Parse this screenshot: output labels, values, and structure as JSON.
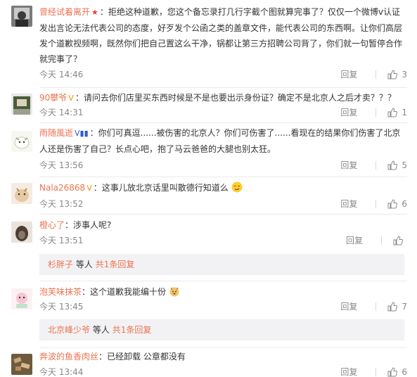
{
  "comments": [
    {
      "user": "曾经试着离开",
      "badge": "★",
      "text_lines": [
        "：拒绝这种道歉，您这个备忘录打几行字截个图就算完事了？仅仅一个微博v认证",
        "发出言论无法代表公司的态度，好歹发个公函之类的盖章文件，能代表公司的东西啊。让你们高层",
        "发个道歉视频啊，既然你们把自己置这么干净，锅都让第三方招聘公司背了，你们就一句暂停合作",
        "就完事了？"
      ],
      "time": "今天 14:46",
      "reply_label": "回复",
      "likes": "3"
    },
    {
      "user": "90攀爷",
      "badge": "V",
      "text_lines": [
        "：请问去你们店里买东西时候是不是也要出示身份证？确定不是北京人之后才卖？？？"
      ],
      "time": "今天 14:31",
      "reply_label": "回复",
      "likes": "1"
    },
    {
      "user": "雨随風逝",
      "badge": "V▮▮",
      "text_lines": [
        "：你们可真逗......被伤害的北京人？你们可伤害了......看现在的结果你们伤害了北京",
        "人还是伤害了自己？长点心吧，抱了马云爸爸的大腿也别太狂。"
      ],
      "time": "今天 13:56",
      "reply_label": "回复",
      "likes": "5"
    },
    {
      "user": "Nala26868",
      "badge": "V",
      "text_lines": [
        "：这事儿放北京话里叫散德行知道么"
      ],
      "time": "今天 13:52",
      "reply_label": "回复",
      "likes": "6"
    },
    {
      "user": "橙心了",
      "badge": "",
      "text_lines": [
        "：涉事人呢?"
      ],
      "time": "今天 13:51",
      "reply_label": "回复",
      "likes": "",
      "sub": {
        "name": "杉胖子",
        "middle": "等人",
        "link": "共1条回复"
      }
    },
    {
      "user": "泡芙味抹茶",
      "badge": "",
      "text_lines": [
        "：这个道歉我能编十份"
      ],
      "time": "今天 13:45",
      "reply_label": "回复",
      "likes": "7",
      "sub": {
        "name": "北京峰少爷",
        "middle": "等人",
        "link": "共1条回复"
      }
    },
    {
      "user": "奔波的鱼香肉丝",
      "badge": "",
      "text_lines": [
        "：已经卸载 公章都没有"
      ],
      "time": "今天 13:44",
      "reply_label": "回复",
      "likes": "6"
    }
  ],
  "colors": {
    "username": "#eb7350",
    "meta": "#888888",
    "subbox_bg": "#f2f2f5"
  },
  "icons": {
    "like": "thumbs-up-icon"
  }
}
